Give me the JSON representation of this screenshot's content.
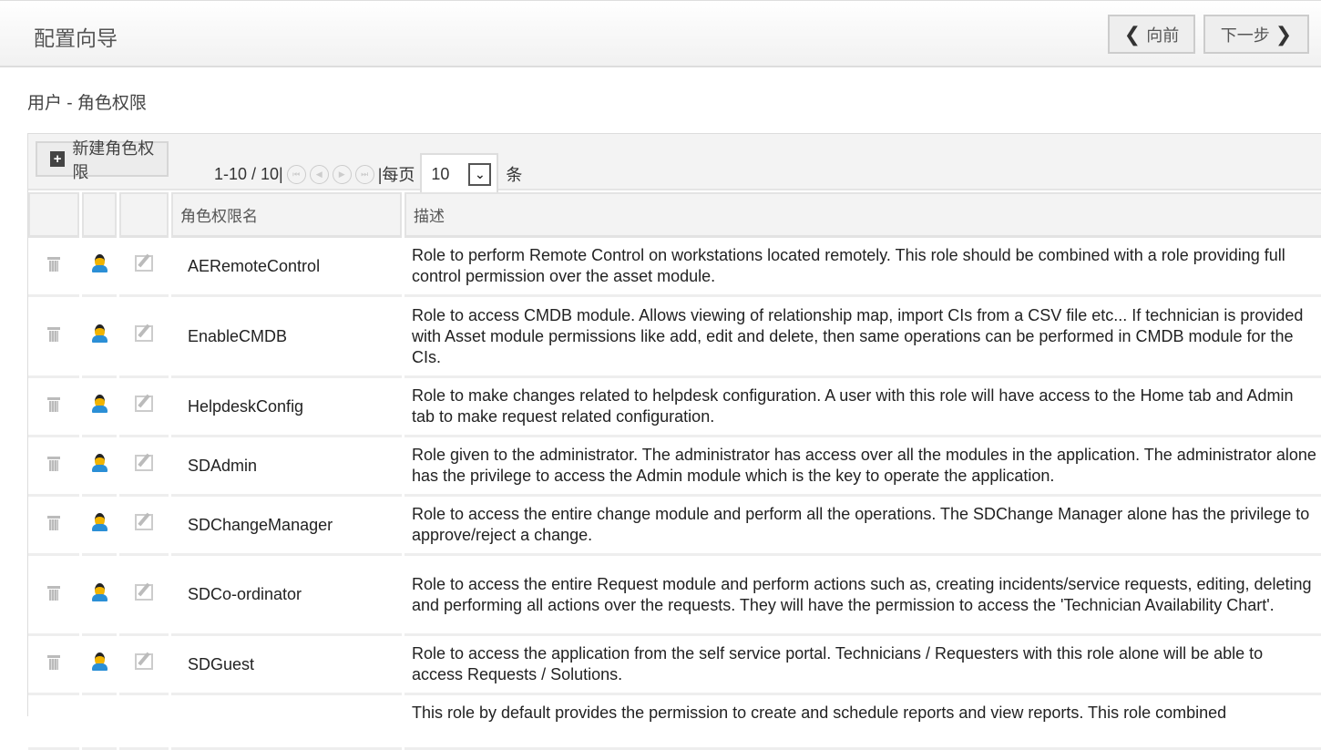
{
  "header": {
    "title": "配置向导",
    "prev_label": "向前",
    "next_label": "下一步"
  },
  "breadcrumb": "用户 - 角色权限",
  "toolbar": {
    "new_label": "新建角色权限",
    "range": "1-10 / 10|",
    "per_page_label": "|每页",
    "per_page_value": "10",
    "per_page_suffix": "条"
  },
  "table": {
    "columns": [
      "角色权限名",
      "描述"
    ],
    "rows": [
      {
        "name": "AERemoteControl",
        "desc": "Role to perform Remote Control on workstations located remotely. This role should be combined with a role providing full control permission over the asset module."
      },
      {
        "name": "EnableCMDB",
        "desc": "Role to access CMDB module. Allows viewing of relationship map, import CIs from a CSV file etc... If technician is provided with Asset module permissions like add, edit and delete, then same operations can be performed in CMDB module for the CIs."
      },
      {
        "name": "HelpdeskConfig",
        "desc": "Role to make changes related to helpdesk configuration. A user with this role will have access to the Home tab and Admin tab to make request related configuration."
      },
      {
        "name": "SDAdmin",
        "desc": "Role given to the administrator. The administrator has access over all the modules in the application. The administrator alone has the privilege to access the Admin module which is the key to operate the application."
      },
      {
        "name": "SDChangeManager",
        "desc": "Role to access the entire change module and perform all the operations. The SDChange Manager alone has the privilege to approve/reject a change."
      },
      {
        "name": "SDCo-ordinator",
        "desc": "Role to access the entire Request module and perform actions such as, creating incidents/service requests, editing, deleting and performing all actions over the requests. They will have the permission to access the 'Technician Availability Chart'."
      },
      {
        "name": "SDGuest",
        "desc": "Role to access the application from the self service portal. Technicians / Requesters with this role alone will be able to access Requests / Solutions."
      },
      {
        "name": "",
        "desc": "This role by default provides the permission to create and schedule reports and view reports. This role combined"
      }
    ]
  }
}
